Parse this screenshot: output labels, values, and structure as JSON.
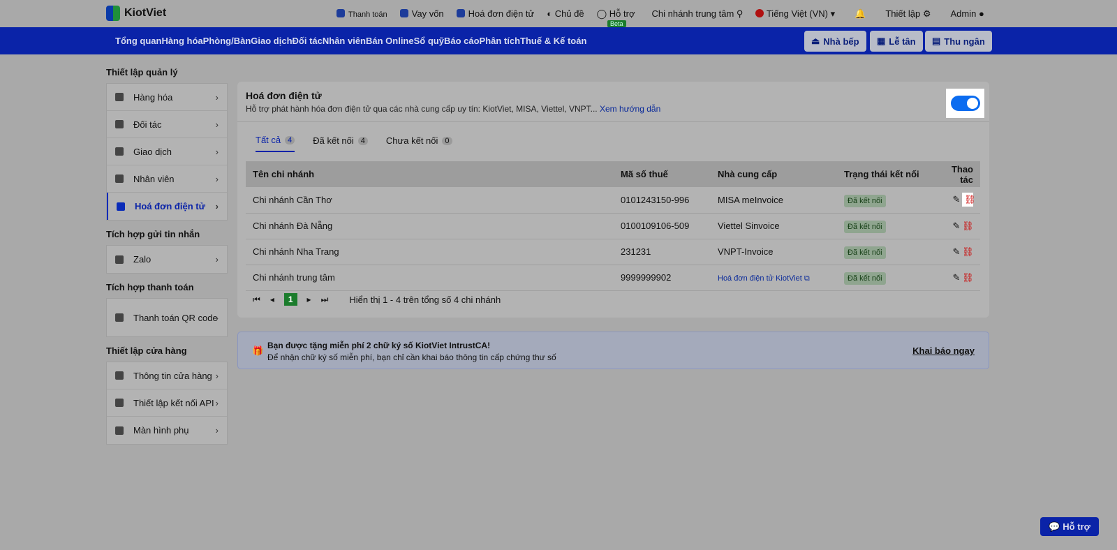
{
  "brand": "KiotViet",
  "topbar": {
    "items": [
      "Thanh toán",
      "Vay vốn",
      "Hoá đơn điện tử",
      "Chủ đề",
      "Hỗ trợ",
      "Chi nhánh trung tâm",
      "Tiếng Việt (VN)"
    ],
    "beta": "Beta",
    "settings": "Thiết lập",
    "user": "Admin"
  },
  "nav": {
    "items": [
      "Tổng quan",
      "Hàng hóa",
      "Phòng/Bàn",
      "Giao dịch",
      "Đối tác",
      "Nhân viên",
      "Bán Online",
      "Sổ quỹ",
      "Báo cáo",
      "Phân tích",
      "Thuế & Kế toán"
    ],
    "buttons": [
      "Nhà bếp",
      "Lễ tân",
      "Thu ngân"
    ]
  },
  "sidebar": {
    "groups": [
      {
        "title": "Thiết lập quản lý",
        "items": [
          "Hàng hóa",
          "Đối tác",
          "Giao dịch",
          "Nhân viên",
          "Hoá đơn điện tử"
        ]
      },
      {
        "title": "Tích hợp gửi tin nhắn",
        "items": [
          "Zalo"
        ]
      },
      {
        "title": "Tích hợp thanh toán",
        "items": [
          "Thanh toán QR code"
        ]
      },
      {
        "title": "Thiết lập cửa hàng",
        "items": [
          "Thông tin cửa hàng",
          "Thiết lập kết nối API",
          "Màn hình phụ"
        ]
      }
    ]
  },
  "card": {
    "title": "Hoá đơn điện tử",
    "subtitle": "Hỗ trợ phát hành hóa đơn điện tử qua các nhà cung cấp uy tín: KiotViet, MISA, Viettel, VNPT...",
    "link": "Xem hướng dẫn",
    "enabled": true,
    "tabs": [
      {
        "label": "Tất cả",
        "count": "4"
      },
      {
        "label": "Đã kết nối",
        "count": "4"
      },
      {
        "label": "Chưa kết nối",
        "count": "0"
      }
    ],
    "columns": [
      "Tên chi nhánh",
      "Mã số thuế",
      "Nhà cung cấp",
      "Trạng thái kết nối",
      "Thao tác"
    ],
    "rows": [
      [
        "Chi nhánh Cần Thơ",
        "0101243150-996",
        "MISA meInvoice",
        "Đã kết nối"
      ],
      [
        "Chi nhánh Đà Nẵng",
        "0100109106-509",
        "Viettel Sinvoice",
        "Đã kết nối"
      ],
      [
        "Chi nhánh Nha Trang",
        "231231",
        "VNPT-Invoice",
        "Đã kết nối"
      ],
      [
        "Chi nhánh trung tâm",
        "9999999902",
        "Hoá đơn điện tử KiotViet",
        "Đã kết nối"
      ]
    ],
    "page": "1",
    "summary": "Hiển thị 1 - 4 trên tổng số 4 chi nhánh"
  },
  "promo": {
    "title": "Bạn được tặng miễn phí 2 chữ ký số KiotViet IntrustCA!",
    "text": "Để nhận chữ ký số miễn phí, bạn chỉ cần khai báo thông tin cấp chứng thư số",
    "action": "Khai báo ngay"
  },
  "help": "Hỗ trợ"
}
